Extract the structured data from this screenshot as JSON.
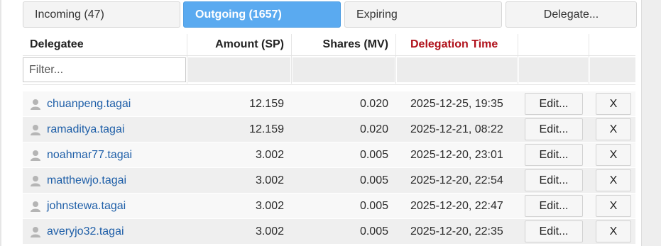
{
  "tabs": [
    {
      "label": "Incoming (47)",
      "active": false
    },
    {
      "label": "Outgoing (1657)",
      "active": true
    },
    {
      "label": "Expiring",
      "active": false
    },
    {
      "label": "Delegate...",
      "active": false
    }
  ],
  "table": {
    "headers": {
      "delegatee": "Delegatee",
      "amount": "Amount (SP)",
      "shares": "Shares (MV)",
      "time": "Delegation Time"
    },
    "filter_placeholder": "Filter...",
    "edit_label": "Edit...",
    "remove_label": "X",
    "rows": [
      {
        "delegatee": "chuanpeng.tagai",
        "amount": "12.159",
        "shares": "0.020",
        "time": "2025-12-25, 19:35"
      },
      {
        "delegatee": "ramaditya.tagai",
        "amount": "12.159",
        "shares": "0.020",
        "time": "2025-12-21, 08:22"
      },
      {
        "delegatee": "noahmar77.tagai",
        "amount": "3.002",
        "shares": "0.005",
        "time": "2025-12-20, 23:01"
      },
      {
        "delegatee": "matthewjo.tagai",
        "amount": "3.002",
        "shares": "0.005",
        "time": "2025-12-20, 22:54"
      },
      {
        "delegatee": "johnstewa.tagai",
        "amount": "3.002",
        "shares": "0.005",
        "time": "2025-12-20, 22:47"
      },
      {
        "delegatee": "averyjo32.tagai",
        "amount": "3.002",
        "shares": "0.005",
        "time": "2025-12-20, 22:35"
      }
    ]
  },
  "colors": {
    "active_tab": "#5aaaf0",
    "link": "#1f5fa8",
    "sorted_header": "#b0101a"
  },
  "icons": {
    "row_user": "user-icon"
  }
}
